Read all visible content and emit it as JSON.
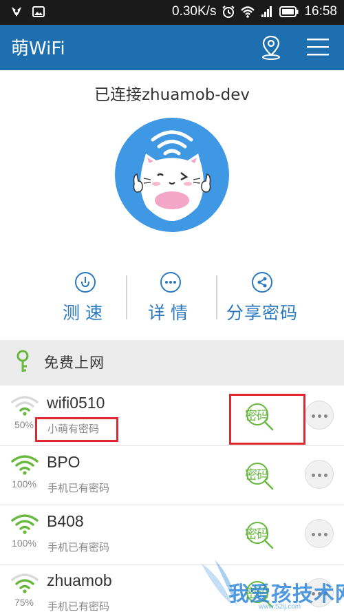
{
  "status_bar": {
    "speed": "0.30K/s",
    "time": "16:58"
  },
  "app": {
    "title": "萌WiFi"
  },
  "connection": {
    "text": "已连接zhuamob-dev"
  },
  "actions": [
    {
      "label": "测速",
      "icon": "speed-gauge-icon"
    },
    {
      "label": "详情",
      "icon": "more-dots-icon"
    },
    {
      "label": "分享密码",
      "icon": "share-icon"
    }
  ],
  "section": {
    "title": "免费上网",
    "icon": "key-icon"
  },
  "networks": [
    {
      "ssid": "wifi0510",
      "signal": "50%",
      "status": "小萌有密码",
      "password_label": "密码",
      "strength": 0.5
    },
    {
      "ssid": "BPO",
      "signal": "100%",
      "status": "手机已有密码",
      "password_label": "密码",
      "strength": 1.0
    },
    {
      "ssid": "B408",
      "signal": "100%",
      "status": "手机已有密码",
      "password_label": "密码",
      "strength": 1.0
    },
    {
      "ssid": "zhuamob",
      "signal": "75%",
      "status": "手机已有密码",
      "password_label": "密码",
      "strength": 0.75
    }
  ],
  "watermark": {
    "text": "我爱孩技术网",
    "url": "www.52ij.com"
  },
  "colors": {
    "header": "#1d6fb0",
    "accent": "#2a78bd",
    "wifi_green": "#67b83d",
    "highlight": "#e0262f"
  }
}
